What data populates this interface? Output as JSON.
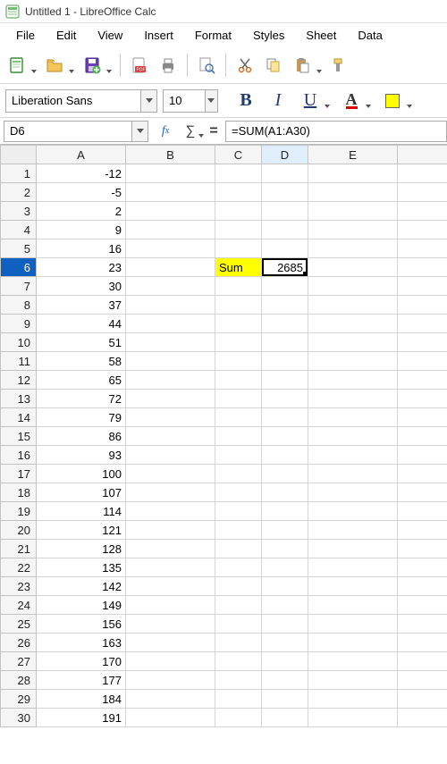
{
  "window": {
    "title": "Untitled 1 - LibreOffice Calc"
  },
  "menu": {
    "file": "File",
    "edit": "Edit",
    "view": "View",
    "insert": "Insert",
    "format": "Format",
    "styles": "Styles",
    "sheet": "Sheet",
    "data": "Data"
  },
  "format_bar": {
    "font_name": "Liberation Sans",
    "font_size": "10",
    "bold": "B",
    "italic": "I",
    "underline": "U",
    "fontcolor_glyph": "A"
  },
  "name_box": {
    "value": "D6"
  },
  "formula_bar": {
    "fx_label_f": "f",
    "fx_label_x": "x",
    "sigma": "∑",
    "equals": "=",
    "formula": "=SUM(A1:A30)"
  },
  "columns": [
    "A",
    "B",
    "C",
    "D",
    "E"
  ],
  "colA_values": [
    -12,
    -5,
    2,
    9,
    16,
    23,
    30,
    37,
    44,
    51,
    58,
    65,
    72,
    79,
    86,
    93,
    100,
    107,
    114,
    121,
    128,
    135,
    142,
    149,
    156,
    163,
    170,
    177,
    184,
    191
  ],
  "sum_label": "Sum",
  "sum_value": "2685",
  "selected_cell": "D6",
  "selected_row": 6,
  "selected_col": "D"
}
